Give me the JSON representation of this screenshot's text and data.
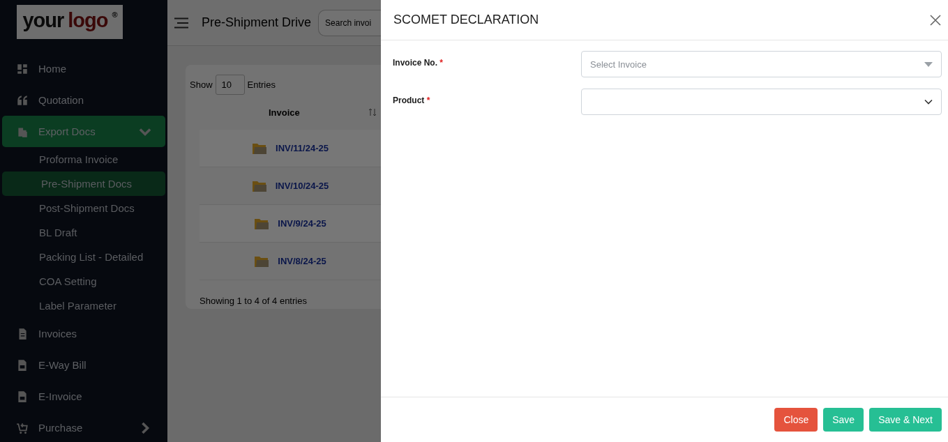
{
  "logo": {
    "text_1": "your",
    "text_2": "logo",
    "mark": "®"
  },
  "sidebar": {
    "items": [
      {
        "label": "Home",
        "kind": "link",
        "selected": false
      },
      {
        "label": "Quotation",
        "kind": "link",
        "selected": false
      },
      {
        "label": "Export Docs",
        "kind": "submenu",
        "selected": true,
        "expanded": true,
        "children": [
          {
            "label": "Proforma Invoice",
            "selected": false
          },
          {
            "label": "Pre-Shipment Docs",
            "selected": true
          },
          {
            "label": "Post-Shipment Docs",
            "selected": false
          },
          {
            "label": "BL Draft",
            "selected": false
          },
          {
            "label": "Packing List - Detailed",
            "selected": false
          },
          {
            "label": "COA Setting",
            "selected": false
          },
          {
            "label": "Label Parameter",
            "selected": false
          }
        ]
      },
      {
        "label": "Invoices",
        "kind": "link",
        "selected": false
      },
      {
        "label": "E-Way Bill",
        "kind": "link",
        "selected": false
      },
      {
        "label": "E-Invoice",
        "kind": "link",
        "selected": false
      },
      {
        "label": "Purchase",
        "kind": "submenu",
        "selected": false,
        "expanded": false
      }
    ]
  },
  "header": {
    "title": "Pre-Shipment Drive",
    "search": {
      "placeholder": "Search invoi"
    }
  },
  "table": {
    "show_label": "Show",
    "page_size": "10",
    "entries_label": "Entries",
    "columns": [
      "Invoice"
    ],
    "rows": [
      {
        "invoice": "INV/11/24-25"
      },
      {
        "invoice": "INV/10/24-25"
      },
      {
        "invoice": "INV/9/24-25"
      },
      {
        "invoice": "INV/8/24-25"
      }
    ],
    "footer": "Showing 1 to 4 of 4 entries"
  },
  "modal": {
    "title": "SCOMET DECLARATION",
    "fields": [
      {
        "label": "Invoice No.",
        "required_mark": "*",
        "kind": "searchable-select",
        "placeholder": "Select Invoice"
      },
      {
        "label": "Product",
        "required_mark": "*",
        "kind": "select"
      }
    ],
    "buttons": [
      {
        "label": "Close",
        "kind": "danger"
      },
      {
        "label": "Save",
        "kind": "success"
      },
      {
        "label": "Save & Next",
        "kind": "success"
      }
    ]
  }
}
